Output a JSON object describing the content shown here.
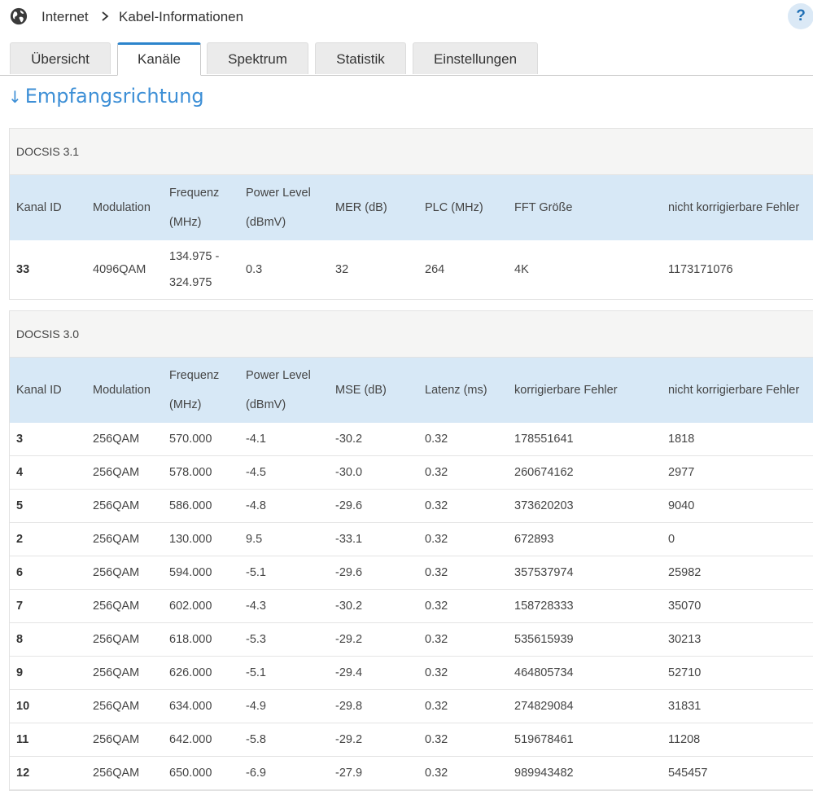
{
  "breadcrumb": {
    "root": "Internet",
    "page": "Kabel-Informationen"
  },
  "help_label": "?",
  "tabs": [
    {
      "label": "Übersicht",
      "active": false
    },
    {
      "label": "Kanäle",
      "active": true
    },
    {
      "label": "Spektrum",
      "active": false
    },
    {
      "label": "Statistik",
      "active": false
    },
    {
      "label": "Einstellungen",
      "active": false
    }
  ],
  "section": {
    "arrow": "↓",
    "title": "Empfangsrichtung"
  },
  "docsis31": {
    "caption": "DOCSIS 3.1",
    "headers": [
      "Kanal ID",
      "Modulation",
      "Frequenz",
      "(MHz)",
      "Power Level",
      "(dBmV)",
      "MER (dB)",
      "PLC (MHz)",
      "FFT Größe",
      "nicht korrigierbare Fehler"
    ],
    "row": [
      "33",
      "4096QAM",
      "134.975 -",
      "324.975",
      "0.3",
      "32",
      "264",
      "4K",
      "1173171076"
    ]
  },
  "docsis30": {
    "caption": "DOCSIS 3.0",
    "headers": [
      "Kanal ID",
      "Modulation",
      "Frequenz",
      "(MHz)",
      "Power Level",
      "(dBmV)",
      "MSE (dB)",
      "Latenz (ms)",
      "korrigierbare Fehler",
      "nicht korrigierbare Fehler"
    ],
    "rows": [
      [
        "3",
        "256QAM",
        "570.000",
        "-4.1",
        "-30.2",
        "0.32",
        "178551641",
        "1818"
      ],
      [
        "4",
        "256QAM",
        "578.000",
        "-4.5",
        "-30.0",
        "0.32",
        "260674162",
        "2977"
      ],
      [
        "5",
        "256QAM",
        "586.000",
        "-4.8",
        "-29.6",
        "0.32",
        "373620203",
        "9040"
      ],
      [
        "2",
        "256QAM",
        "130.000",
        "9.5",
        "-33.1",
        "0.32",
        "672893",
        "0"
      ],
      [
        "6",
        "256QAM",
        "594.000",
        "-5.1",
        "-29.6",
        "0.32",
        "357537974",
        "25982"
      ],
      [
        "7",
        "256QAM",
        "602.000",
        "-4.3",
        "-30.2",
        "0.32",
        "158728333",
        "35070"
      ],
      [
        "8",
        "256QAM",
        "618.000",
        "-5.3",
        "-29.2",
        "0.32",
        "535615939",
        "30213"
      ],
      [
        "9",
        "256QAM",
        "626.000",
        "-5.1",
        "-29.4",
        "0.32",
        "464805734",
        "52710"
      ],
      [
        "10",
        "256QAM",
        "634.000",
        "-4.9",
        "-29.8",
        "0.32",
        "274829084",
        "31831"
      ],
      [
        "11",
        "256QAM",
        "642.000",
        "-5.8",
        "-29.2",
        "0.32",
        "519678461",
        "11208"
      ],
      [
        "12",
        "256QAM",
        "650.000",
        "-6.9",
        "-27.9",
        "0.32",
        "989943482",
        "545457"
      ]
    ]
  },
  "colors": {
    "accent": "#2c84cc",
    "title": "#3d8fd6",
    "header_bg": "#d7e8f6",
    "caption_bg": "#f5f5f4"
  },
  "icons": {
    "globe": "globe-icon",
    "separator": "chevron-right-icon",
    "help": "help-icon"
  }
}
